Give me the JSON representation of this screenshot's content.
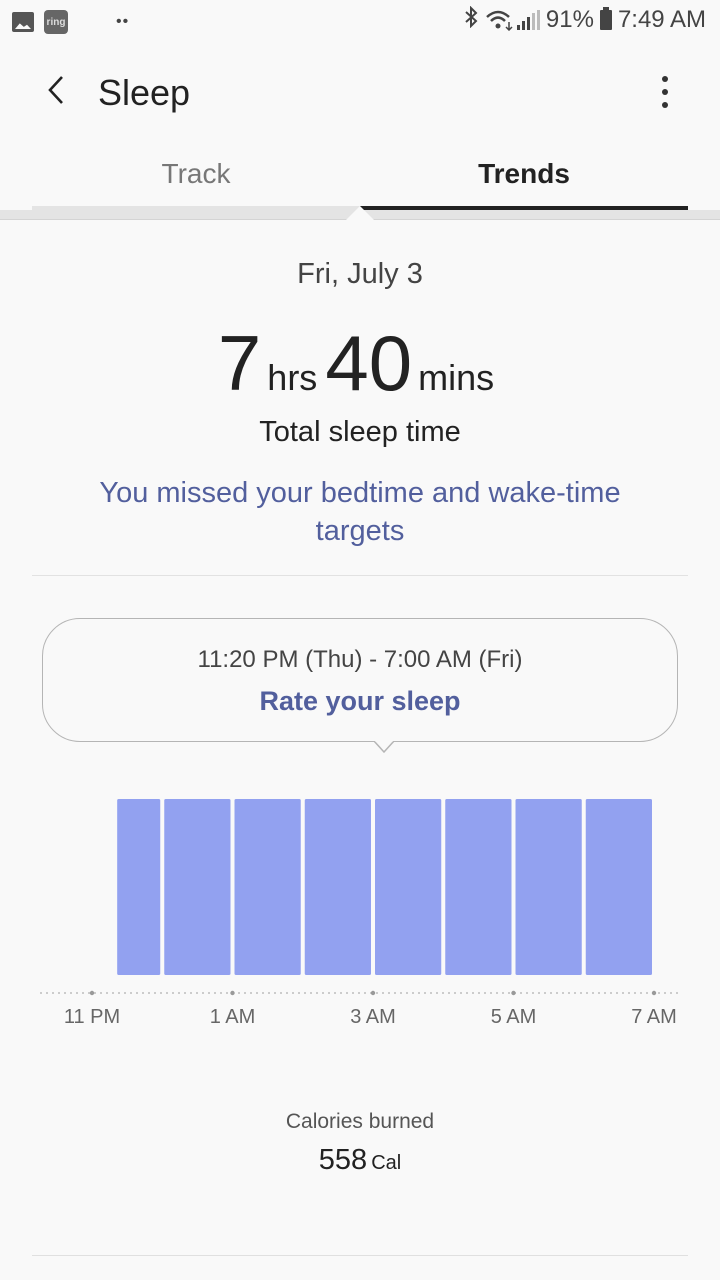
{
  "status_bar": {
    "notification_icons": [
      "gallery-icon",
      "ring-app-icon",
      "more-notifications-icon"
    ],
    "ring_label": "ring",
    "dots": "••",
    "bluetooth": "bluetooth-icon",
    "wifi": "wifi-icon",
    "signal": "signal-icon",
    "battery_percent": "91%",
    "time": "7:49 AM"
  },
  "app_bar": {
    "title": "Sleep",
    "back_icon": "back-arrow-icon",
    "more_icon": "more-options-icon"
  },
  "tabs": [
    {
      "label": "Track",
      "selected": false
    },
    {
      "label": "Trends",
      "selected": true
    }
  ],
  "summary": {
    "date": "Fri, July 3",
    "hours": "7",
    "hours_unit": "hrs",
    "minutes": "40",
    "minutes_unit": "mins",
    "label": "Total sleep time",
    "message": "You missed your bedtime and wake-time targets"
  },
  "session": {
    "time_range": "11:20 PM (Thu) - 7:00 AM (Fri)",
    "rate_label": "Rate your sleep"
  },
  "colors": {
    "accent": "#525f9d",
    "bar": "#92a1f0",
    "background": "#f9f9f9"
  },
  "chart_data": {
    "type": "bar",
    "title": "",
    "xlabel": "",
    "ylabel": "",
    "x_range_hours": [
      23,
      31
    ],
    "x_ticks": [
      {
        "hour": 23,
        "label": "11 PM"
      },
      {
        "hour": 25,
        "label": "1 AM"
      },
      {
        "hour": 27,
        "label": "3 AM"
      },
      {
        "hour": 29,
        "label": "5 AM"
      },
      {
        "hour": 31,
        "label": "7 AM"
      }
    ],
    "segments": [
      {
        "start": "11:20 PM",
        "end": "12:00 AM",
        "start_h": 23.33,
        "end_h": 24,
        "level": 1
      },
      {
        "start": "12:00 AM",
        "end": "1:00 AM",
        "start_h": 24,
        "end_h": 25,
        "level": 1
      },
      {
        "start": "1:00 AM",
        "end": "2:00 AM",
        "start_h": 25,
        "end_h": 26,
        "level": 1
      },
      {
        "start": "2:00 AM",
        "end": "3:00 AM",
        "start_h": 26,
        "end_h": 27,
        "level": 1
      },
      {
        "start": "3:00 AM",
        "end": "4:00 AM",
        "start_h": 27,
        "end_h": 28,
        "level": 1
      },
      {
        "start": "4:00 AM",
        "end": "5:00 AM",
        "start_h": 28,
        "end_h": 29,
        "level": 1
      },
      {
        "start": "5:00 AM",
        "end": "6:00 AM",
        "start_h": 29,
        "end_h": 30,
        "level": 1
      },
      {
        "start": "6:00 AM",
        "end": "7:00 AM",
        "start_h": 30,
        "end_h": 31,
        "level": 1
      }
    ],
    "grid": false,
    "legend": "none"
  },
  "calories": {
    "label": "Calories burned",
    "value": "558",
    "unit": "Cal"
  }
}
